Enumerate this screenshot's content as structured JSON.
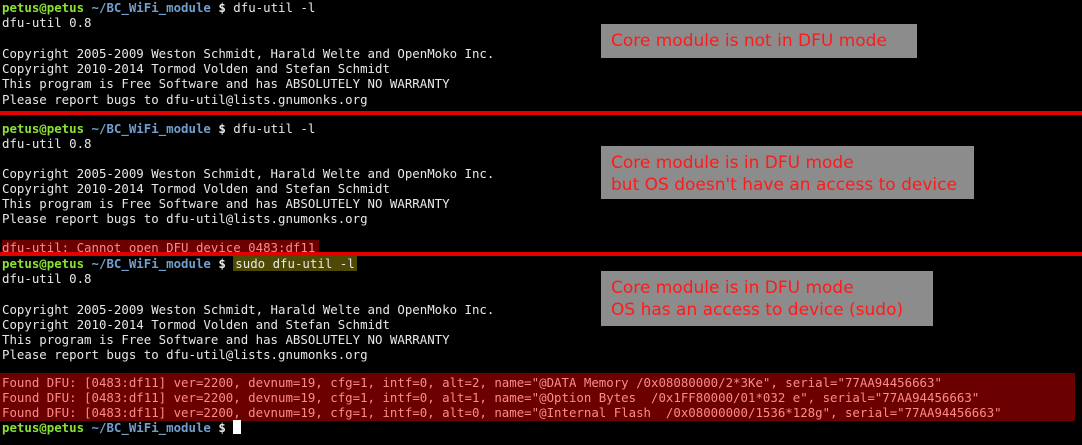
{
  "prompt": {
    "user": "petus@petus",
    "path": "~/BC_WiFi_module",
    "dollar": "$"
  },
  "sections": [
    {
      "command": "dfu-util -l",
      "output": [
        "dfu-util 0.8",
        "",
        "Copyright 2005-2009 Weston Schmidt, Harald Welte and OpenMoko Inc.",
        "Copyright 2010-2014 Tormod Volden and Stefan Schmidt",
        "This program is Free Software and has ABSOLUTELY NO WARRANTY",
        "Please report bugs to dfu-util@lists.gnumonks.org"
      ],
      "note": "Core module is not in DFU mode"
    },
    {
      "command": "dfu-util -l",
      "output": [
        "dfu-util 0.8",
        "",
        "Copyright 2005-2009 Weston Schmidt, Harald Welte and OpenMoko Inc.",
        "Copyright 2010-2014 Tormod Volden and Stefan Schmidt",
        "This program is Free Software and has ABSOLUTELY NO WARRANTY",
        "Please report bugs to dfu-util@lists.gnumonks.org"
      ],
      "error": "dfu-util: Cannot open DFU device 0483:df11",
      "note": "Core module is in DFU mode\nbut OS doesn't have an access to device"
    },
    {
      "command": "sudo dfu-util -l",
      "output": [
        "dfu-util 0.8",
        "",
        "Copyright 2005-2009 Weston Schmidt, Harald Welte and OpenMoko Inc.",
        "Copyright 2010-2014 Tormod Volden and Stefan Schmidt",
        "This program is Free Software and has ABSOLUTELY NO WARRANTY",
        "Please report bugs to dfu-util@lists.gnumonks.org"
      ],
      "found": [
        "Found DFU: [0483:df11] ver=2200, devnum=19, cfg=1, intf=0, alt=2, name=\"@DATA Memory /0x08080000/2*3Ke\", serial=\"77AA94456663\"",
        "Found DFU: [0483:df11] ver=2200, devnum=19, cfg=1, intf=0, alt=1, name=\"@Option Bytes  /0x1FF80000/01*032 e\", serial=\"77AA94456663\"",
        "Found DFU: [0483:df11] ver=2200, devnum=19, cfg=1, intf=0, alt=0, name=\"@Internal Flash  /0x08000000/1536*128g\", serial=\"77AA94456663\""
      ],
      "note": "Core module is in DFU mode\nOS has an access to device (sudo)"
    }
  ],
  "colors": {
    "separator": "#e00000",
    "note_background": "#8c8c8c",
    "note_text": "#ff1a1a",
    "error_background": "#6b0000"
  }
}
